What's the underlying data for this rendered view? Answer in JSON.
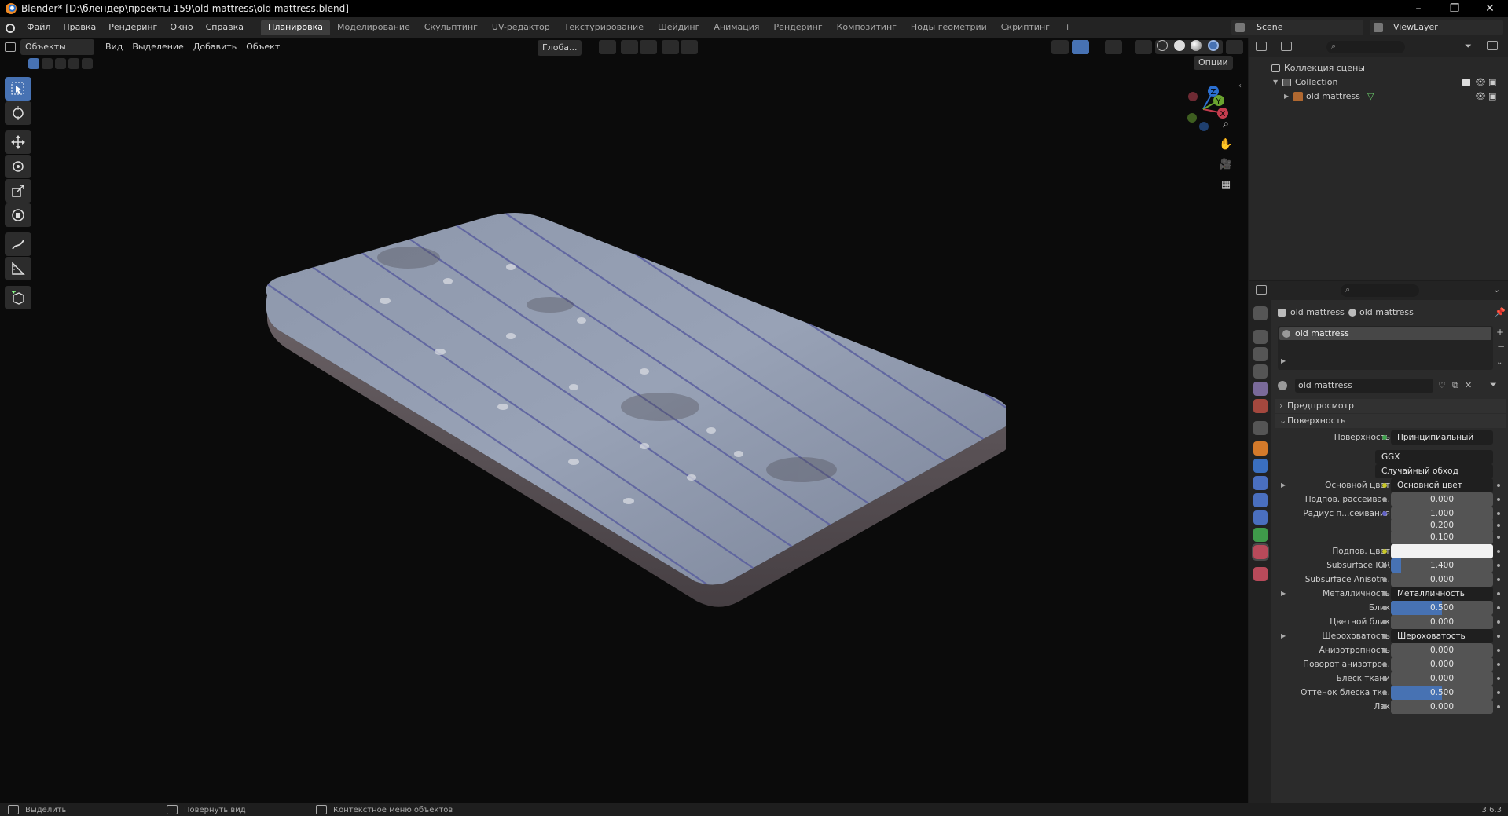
{
  "window": {
    "title": "Blender* [D:\\блендер\\проекты 159\\old mattress\\old mattress.blend]",
    "controls": [
      "–",
      "❐",
      "✕"
    ]
  },
  "menu": [
    "Файл",
    "Правка",
    "Рендеринг",
    "Окно",
    "Справка"
  ],
  "workspaces": [
    {
      "label": "Планировка",
      "active": true
    },
    {
      "label": "Моделирование"
    },
    {
      "label": "Скульптинг"
    },
    {
      "label": "UV-редактор"
    },
    {
      "label": "Текстурирование"
    },
    {
      "label": "Шейдинг"
    },
    {
      "label": "Анимация"
    },
    {
      "label": "Рендеринг"
    },
    {
      "label": "Композитинг"
    },
    {
      "label": "Ноды геометрии"
    },
    {
      "label": "Скриптинг"
    }
  ],
  "add_workspace": "+",
  "scene": {
    "name": "Scene",
    "view_layer": "ViewLayer"
  },
  "viewport": {
    "mode": "Объекты",
    "menus": [
      "Вид",
      "Выделение",
      "Добавить",
      "Объект"
    ],
    "orientation": "Глоба...",
    "options": "Опции",
    "gizmo": {
      "z": "Z",
      "y": "Y",
      "x": "X"
    }
  },
  "outliner": {
    "root": "Коллекция сцены",
    "collection": "Collection",
    "object": "old mattress"
  },
  "properties": {
    "breadcrumb_object": "old mattress",
    "breadcrumb_material": "old mattress",
    "slot": "old mattress",
    "material_name": "old mattress",
    "panels": {
      "preview": "Предпросмотр",
      "surface": "Поверхность"
    },
    "surface_label": "Поверхность",
    "surface_value": "Принципиальный BSDF",
    "distribution": "GGX",
    "subsurface_method": "Случайный обход",
    "rows": [
      {
        "label": "Основной цвет",
        "value": "Основной цвет",
        "kind": "link",
        "dot": "#c7c729"
      },
      {
        "label": "Подпов. рассеива...",
        "value": "0.000",
        "kind": "num",
        "dot": "#a1a1a1"
      },
      {
        "label": "Радиус п...сеивания",
        "value": "1.000",
        "kind": "num",
        "dot": "#6363c7"
      },
      {
        "label": "",
        "value": "0.200",
        "kind": "num"
      },
      {
        "label": "",
        "value": "0.100",
        "kind": "num"
      },
      {
        "label": "Подпов. цвет",
        "value": "",
        "kind": "color",
        "dot": "#c7c729"
      },
      {
        "label": "Subsurface IOR",
        "value": "1.400",
        "kind": "num",
        "fill": 0.1,
        "dot": "#a1a1a1"
      },
      {
        "label": "Subsurface Anisotr...",
        "value": "0.000",
        "kind": "num",
        "dot": "#a1a1a1"
      },
      {
        "label": "Металличность",
        "value": "Металличность",
        "kind": "link",
        "dot": "#a1a1a1"
      },
      {
        "label": "Блик",
        "value": "0.500",
        "kind": "num",
        "fill": 0.5,
        "dot": "#a1a1a1"
      },
      {
        "label": "Цветной блик",
        "value": "0.000",
        "kind": "num",
        "dot": "#a1a1a1"
      },
      {
        "label": "Шероховатость",
        "value": "Шероховатость",
        "kind": "link",
        "dot": "#a1a1a1"
      },
      {
        "label": "Анизотропность",
        "value": "0.000",
        "kind": "num",
        "dot": "#a1a1a1"
      },
      {
        "label": "Поворот анизотро...",
        "value": "0.000",
        "kind": "num",
        "dot": "#a1a1a1"
      },
      {
        "label": "Блеск ткани",
        "value": "0.000",
        "kind": "num",
        "dot": "#a1a1a1"
      },
      {
        "label": "Оттенок блеска тк...",
        "value": "0.500",
        "kind": "num",
        "fill": 0.5,
        "dot": "#a1a1a1"
      },
      {
        "label": "Лак",
        "value": "0.000",
        "kind": "num",
        "dot": "#a1a1a1"
      }
    ]
  },
  "status": {
    "select": "Выделить",
    "rotate": "Повернуть вид",
    "context": "Контекстное меню объектов",
    "version": "3.6.3"
  },
  "colors": {
    "accent": "#4772b3",
    "active_tab": "#3d3d3d"
  }
}
